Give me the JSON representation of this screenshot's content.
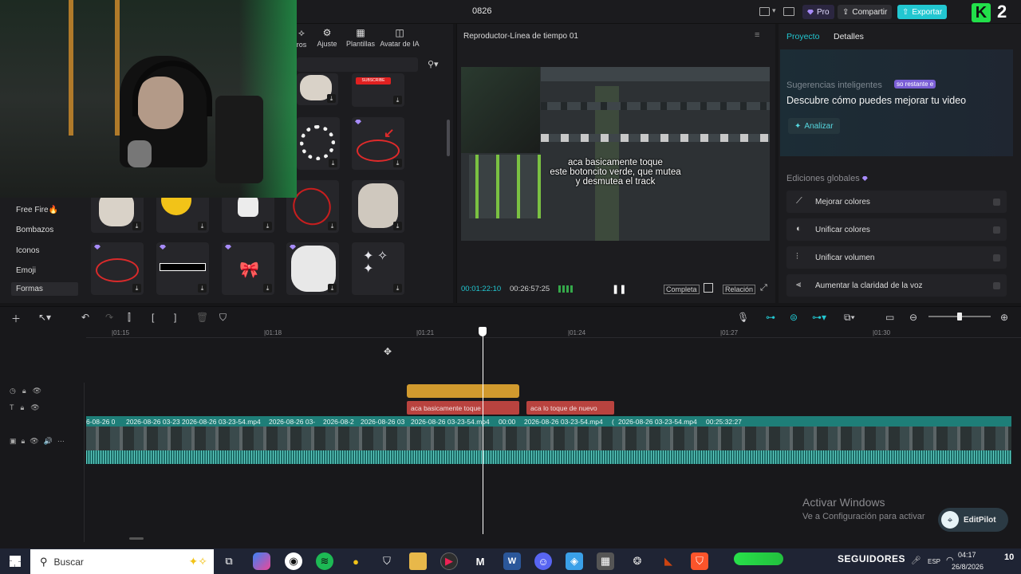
{
  "window": {
    "project_title": "0826",
    "pro_label": "Pro",
    "share_label": "Compartir",
    "export_label": "Exportar"
  },
  "assets_panel": {
    "tools": [
      {
        "label": "ros",
        "icon": "effects-icon"
      },
      {
        "label": "Ajuste",
        "icon": "adjust-icon"
      },
      {
        "label": "Plantillas",
        "icon": "templates-icon"
      },
      {
        "label": "Avatar de IA",
        "icon": "avatar-icon"
      }
    ],
    "categories": [
      "Free Fire🔥",
      "Bombazos",
      "Iconos",
      "Emoji",
      "Formas"
    ],
    "selected_category": "Formas",
    "subscribe_sticker_text": "SUBSCRIBE"
  },
  "player": {
    "title": "Reproductor-Línea de tiempo 01",
    "caption_line1": "aca basicamente toque",
    "caption_line2": "este botoncito verde, que mutea",
    "caption_line3": "y desmutea el track",
    "current_time": "00:01:22:10",
    "total_time": "00:26:57:25",
    "complete_label": "Completa",
    "ratio_label": "Relación"
  },
  "right_panel": {
    "tab_project": "Proyecto",
    "tab_details": "Detalles",
    "suggestions_title": "Sugerencias inteligentes",
    "suggestions_badge": "so restante e",
    "suggestions_heading": "Descubre cómo puedes mejorar tu video",
    "analyze_label": "Analizar",
    "global_edits_title": "Ediciones globales",
    "global_edits": [
      {
        "label": "Mejorar colores",
        "icon": "magic-wand-icon"
      },
      {
        "label": "Unificar colores",
        "icon": "palette-icon"
      },
      {
        "label": "Unificar volumen",
        "icon": "equalizer-icon"
      },
      {
        "label": "Aumentar la claridad de la voz",
        "icon": "voice-icon"
      }
    ]
  },
  "timeline": {
    "ruler": [
      "|01:15",
      "|01:18",
      "|01:21",
      "|01:24",
      "|01:27",
      "|01:30"
    ],
    "text_clips": [
      "aca basicamente toque",
      "aca lo toque de nuevo"
    ],
    "video_clip_names": [
      "6-08-26 0",
      "2026-08-26 03-23",
      "2026-08-26 03-23-54.mp4",
      "2026-08-26 03-",
      "2026-08-2",
      "2026-08-26 03",
      "2026-08-26 03-23-54.mp4",
      "00:00",
      "2026-08-26 03-23-54.mp4",
      "(",
      "2026-08-26 03-23-54.mp4",
      "00:25:32:27"
    ]
  },
  "watermark": {
    "title": "Activar Windows",
    "subtitle": "Ve a Configuración para activar"
  },
  "editpilot_label": "EditPilot",
  "taskbar": {
    "search_placeholder": "Buscar",
    "followers_label": "SEGUIDORES",
    "lang": "ESP",
    "clock_time": "04:17",
    "clock_date": "26/8/2026",
    "notif_count": "10"
  },
  "stream_overlay": {
    "rank_number": "2"
  },
  "colors": {
    "accent_cyan": "#22c7d1",
    "pro_purple": "#a78bfa",
    "playhead": "#ffffff",
    "orange_clip": "#d19a2e",
    "red_text_clip": "#b9433f",
    "video_track": "#1e7e78"
  }
}
